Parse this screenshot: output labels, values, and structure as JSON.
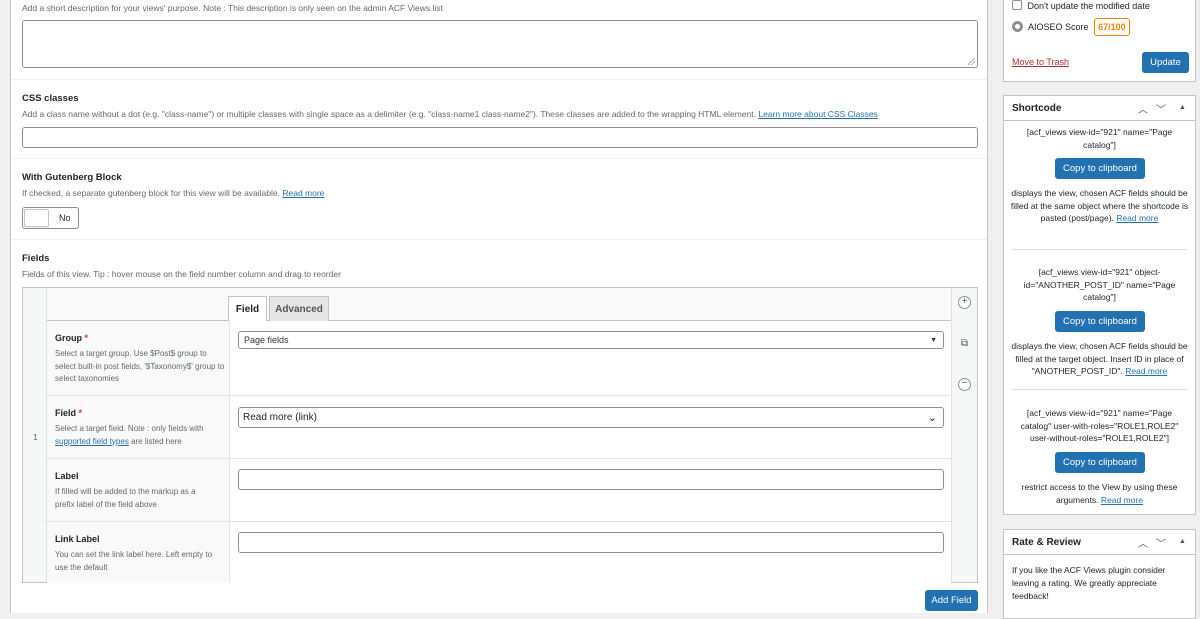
{
  "main": {
    "description": {
      "help": "Add a short description for your views' purpose. Note : This description is only seen on the admin ACF Views list"
    },
    "css_classes": {
      "title": "CSS classes",
      "help": "Add a class name without a dot (e.g. \"class-name\") or multiple classes with single space as a delimiter (e.g. \"class-name1 class-name2\"). These classes are added to the wrapping HTML element.",
      "link": "Learn more about CSS Classes"
    },
    "gutenberg": {
      "title": "With Gutenberg Block",
      "help": "If checked, a separate gutenberg block for this view will be available.",
      "link": "Read more",
      "toggle_label": "No"
    },
    "fields": {
      "title": "Fields",
      "help": "Fields of this view. Tip : hover mouse on the field number column and drag to reorder",
      "row_number": "1",
      "tabs": [
        "Field",
        "Advanced"
      ],
      "group": {
        "label": "Group",
        "required": "*",
        "help": "Select a target group. Use $Post$ group to select built-in post fields, '$Taxonomy$' group to select taxonomies",
        "value": "Page fields"
      },
      "field": {
        "label": "Field",
        "required": "*",
        "help_pre": "Select a target field. Note : only fields with",
        "help_link": "supported field types",
        "help_post": "are listed here",
        "value": "Read more (link)"
      },
      "label": {
        "label": "Label",
        "help": "If filled will be added to the markup as a prefix label of the field above"
      },
      "link_label": {
        "label": "Link Label",
        "help": "You can set the link label here. Left empty to use the default"
      },
      "controls": {
        "add": "+",
        "remove": "−"
      },
      "add_button": "Add Field"
    }
  },
  "sidebar": {
    "publish": {
      "checkbox_label": "Don't update the modified date",
      "aioseo_label": "AIOSEO Score",
      "aioseo_score": "67/100",
      "trash_link": "Move to Trash",
      "update_button": "Update"
    },
    "shortcode": {
      "title": "Shortcode",
      "items": [
        {
          "code": "[acf_views view-id=\"921\" name=\"Page catalog\"]",
          "button": "Copy to clipboard",
          "desc": "displays the view, chosen ACF fields should be filled at the same object where the shortcode is pasted (post/page).",
          "link": "Read more"
        },
        {
          "code": "[acf_views view-id=\"921\" object-id=\"ANOTHER_POST_ID\" name=\"Page catalog\"]",
          "button": "Copy to clipboard",
          "desc": "displays the view, chosen ACF fields should be filled at the target object. Insert ID in place of \"ANOTHER_POST_ID\".",
          "link": "Read more"
        },
        {
          "code": "[acf_views view-id=\"921\" name=\"Page catalog\" user-with-roles=\"ROLE1,ROLE2\" user-without-roles=\"ROLE1,ROLE2\"]",
          "button": "Copy to clipboard",
          "desc": "restrict access to the View by using these arguments.",
          "link": "Read more"
        }
      ]
    },
    "rate": {
      "title": "Rate & Review",
      "text": "If you like the ACF Views plugin consider leaving a rating. We greatly appreciate feedback!"
    },
    "header_icons": [
      "chevron-up-icon",
      "chevron-down-icon",
      "triangle-up-icon"
    ]
  },
  "colors": {
    "primary": "#2271b1",
    "score_orange": "#f18200",
    "required_red": "#d63638"
  }
}
